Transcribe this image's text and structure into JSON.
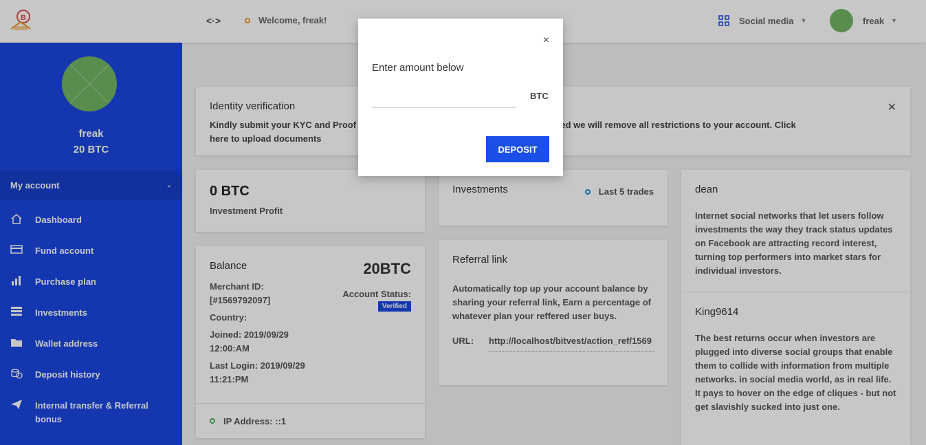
{
  "header": {
    "toggle_icon_text": "<·>",
    "welcome": "Welcome, freak!",
    "language_label": "Social media",
    "username": "freak",
    "colors": {
      "accent_orange": "#e89b2c"
    }
  },
  "sidebar": {
    "profile_name": "freak",
    "profile_balance": "20 BTC",
    "section_label": "My account",
    "items": [
      {
        "icon": "home-icon",
        "label": "Dashboard"
      },
      {
        "icon": "card-icon",
        "label": "Fund account"
      },
      {
        "icon": "bar-chart-icon",
        "label": "Purchase plan"
      },
      {
        "icon": "database-icon",
        "label": "Investments"
      },
      {
        "icon": "folder-icon",
        "label": "Wallet address"
      },
      {
        "icon": "coins-icon",
        "label": "Deposit history"
      },
      {
        "icon": "send-icon",
        "label": "Internal transfer & Referral bonus"
      }
    ],
    "colors": {
      "bg": "#1a47e0"
    }
  },
  "kyc": {
    "title": "Identity verification",
    "text": "Kindly submit your KYC and Proof o… …tion is completed we will remove all restrictions to your account. Click here to upload documents",
    "text_left": "Kindly submit your KYC and Proof o",
    "text_right": "tion is completed we will remove all restrictions to your account. Click",
    "text_line2": "here to upload documents"
  },
  "profit": {
    "amount": "0 BTC",
    "label": "Investment Profit"
  },
  "balance": {
    "title": "Balance",
    "amount": "20BTC",
    "merchant_label": "Merchant ID:",
    "merchant_id": "[#1569792097]",
    "country_label": "Country:",
    "joined": "Joined: 2019/09/29 12:00:AM",
    "last_login": "Last Login: 2019/09/29 11:21:PM",
    "status_label": "Account Status:",
    "status_badge": "Verified",
    "ip_address": "IP Address: ::1"
  },
  "investments": {
    "title": "Investments",
    "filter_label": "Last 5 trades"
  },
  "referral": {
    "title": "Referral link",
    "description": "Automatically top up your account balance by sharing your referral link, Earn a percentage of whatever plan your reffered user buys.",
    "url_label": "URL:",
    "url": "http://localhost/bitvest/action_ref/1569"
  },
  "feed": {
    "posts": [
      {
        "author": "dean",
        "text": "Internet social networks that let users follow investments the way they track status updates on Facebook are attracting record interest, turning top performers into market stars for individual investors."
      },
      {
        "author": "King9614",
        "text": "The best returns occur when investors are plugged into diverse social groups that enable them to collide with information from multiple networks. in social media world, as in real life. It pays to hover on the edge of cliques - but not get slavishly sucked into just one."
      }
    ]
  },
  "modal": {
    "title": "Enter amount below",
    "input_value": "",
    "unit": "BTC",
    "button_label": "DEPOSIT",
    "close_label": "×"
  }
}
